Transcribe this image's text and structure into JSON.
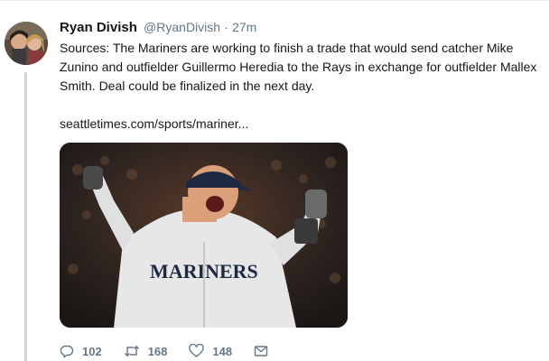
{
  "tweet": {
    "author_name": "Ryan Divish",
    "handle": "@RyanDivish",
    "separator": "·",
    "time": "27m",
    "text": "Sources: The Mariners are working to finish a trade that would send catcher Mike Zunino and outfielder Guillermo Heredia to the Rays in exchange for outfielder Mallex Smith. Deal could be finalized in the next day.",
    "link_text": "seattletimes.com/sports/mariner...",
    "image_jersey_text": "MARINERS"
  },
  "actions": {
    "reply_count": "102",
    "retweet_count": "168",
    "like_count": "148"
  },
  "icons": {
    "reply": "reply-icon",
    "retweet": "retweet-icon",
    "like": "heart-icon",
    "message": "envelope-icon"
  },
  "colors": {
    "text": "#14171a",
    "muted": "#657786",
    "thread_line": "#ccd6dd"
  }
}
